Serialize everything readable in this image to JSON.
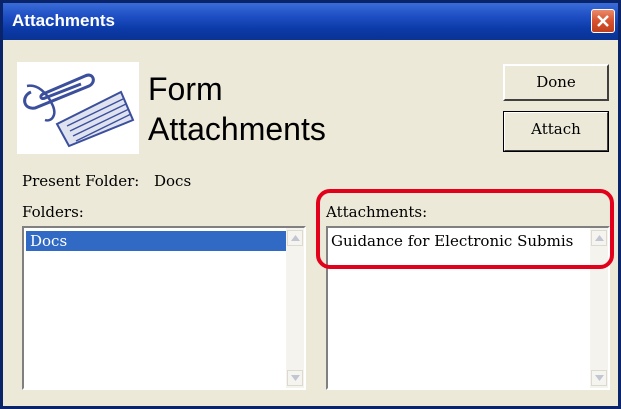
{
  "window": {
    "title": "Attachments"
  },
  "header": {
    "line1": "Form",
    "line2": "Attachments",
    "icon": "paperclip-document-icon"
  },
  "buttons": {
    "done": "Done",
    "attach": "Attach"
  },
  "present_folder": {
    "label": "Present Folder:",
    "value": "Docs"
  },
  "folders": {
    "label": "Folders:",
    "items": [
      "Docs"
    ],
    "selected": "Docs"
  },
  "attachments": {
    "label": "Attachments:",
    "items": [
      "Guidance for Electronic Submis"
    ]
  },
  "colors": {
    "title_bar": "#0a3392",
    "selection": "#316ac5",
    "highlight": "#e3001b",
    "dialog_bg": "#ece9d8"
  }
}
